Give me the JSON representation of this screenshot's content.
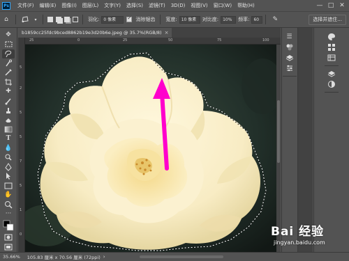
{
  "app": {
    "logo": "Ps"
  },
  "menu": [
    "文件(F)",
    "编辑(E)",
    "图像(I)",
    "图层(L)",
    "文字(Y)",
    "选择(S)",
    "滤镜(T)",
    "3D(D)",
    "视图(V)",
    "窗口(W)",
    "帮助(H)"
  ],
  "window_controls": {
    "minimize": "—",
    "maximize": "□",
    "close": "✕"
  },
  "options": {
    "feather_label": "羽化:",
    "feather_value": "0 像素",
    "antialias_label": "消除锯齿",
    "antialias_checked": true,
    "width_label": "宽度:",
    "width_value": "10 像素",
    "contrast_label": "对比度:",
    "contrast_value": "10%",
    "frequency_label": "频率:",
    "frequency_value": "60",
    "select_mask_label": "选择并遮住..."
  },
  "document": {
    "tab_title": "b1859cc25fdc9bced8862b19e3d20b6e.jpeg @ 35.7%(RGB/8)",
    "tab_close": "×"
  },
  "rulers": {
    "top": [
      "25",
      "0",
      "25",
      "50",
      "75",
      "100"
    ],
    "left": [
      "5",
      "2",
      "5",
      "5",
      "7",
      "5",
      "1",
      "0"
    ]
  },
  "status": {
    "zoom": "35.66%",
    "doc_size": "105.83 厘米 x 70.56 厘米 (72ppi)",
    "arrow": "›"
  },
  "watermark": {
    "logo": "Bai 经验",
    "url": "jingyan.baidu.com"
  },
  "colors": {
    "ui_bg": "#535353",
    "ui_dark": "#424242",
    "canvas_bg": "#282828",
    "arrow": "#ff00cc",
    "petal": "#fbf3d6",
    "petal_shadow": "#e9d9a4",
    "stamen": "#d89b3a"
  },
  "icons": {
    "toolbar": [
      "move-icon",
      "marquee-icon",
      "magnetic-lasso-icon",
      "quick-select-icon",
      "crop-icon",
      "eyedropper-icon",
      "spot-heal-icon",
      "brush-icon",
      "clone-stamp-icon",
      "history-brush-icon",
      "eraser-icon",
      "gradient-icon",
      "blur-icon",
      "dodge-icon",
      "pen-icon",
      "type-icon",
      "path-select-icon",
      "rectangle-icon",
      "hand-icon",
      "zoom-icon",
      "more-icon",
      "swap-colors-icon",
      "color-swatches-icon",
      "quick-mask-icon",
      "screen-mode-icon"
    ],
    "panel_strip_1": [
      "history-icon",
      "properties-icon",
      "layers-icon",
      "adjustments-icon",
      "swatches-icon"
    ],
    "panel_strip_3": [
      "layers-panel-icon",
      "channels-icon",
      "paths-icon",
      "libraries-icon",
      "adjust-icon",
      "color-icon"
    ]
  }
}
